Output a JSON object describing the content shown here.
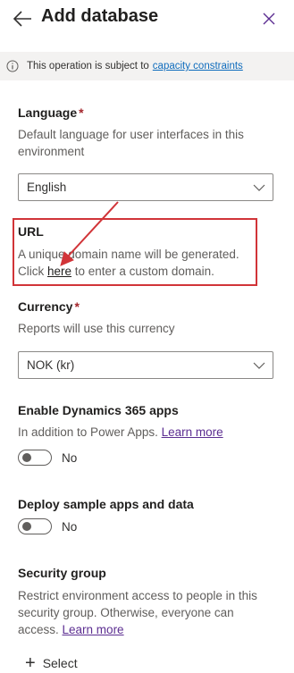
{
  "header": {
    "title": "Add database",
    "back_icon": "arrow-left-icon",
    "close_icon": "close-icon"
  },
  "notice": {
    "text": "This operation is subject to",
    "link": "capacity constraints",
    "icon": "info-icon"
  },
  "language": {
    "label": "Language",
    "required": "*",
    "description": "Default language for user interfaces in this environment",
    "value": "English"
  },
  "url": {
    "label": "URL",
    "desc_before": "A unique domain name will be generated. Click ",
    "desc_link": "here",
    "desc_after": " to enter a custom domain."
  },
  "currency": {
    "label": "Currency",
    "required": "*",
    "description": "Reports will use this currency",
    "value": "NOK (kr)"
  },
  "dynamics": {
    "label": "Enable Dynamics 365 apps",
    "desc_before": "In addition to Power Apps. ",
    "desc_link": "Learn more",
    "toggle_label": "No",
    "enabled": false
  },
  "sample": {
    "label": "Deploy sample apps and data",
    "toggle_label": "No",
    "enabled": false
  },
  "security": {
    "label": "Security group",
    "desc_before": "Restrict environment access to people in this security group. Otherwise, everyone can access. ",
    "desc_link": "Learn more",
    "select_label": "Select"
  },
  "colors": {
    "accent": "#0f6cbd",
    "link_visited": "#5c2e91",
    "highlight": "#d13438",
    "required": "#a4262c"
  }
}
